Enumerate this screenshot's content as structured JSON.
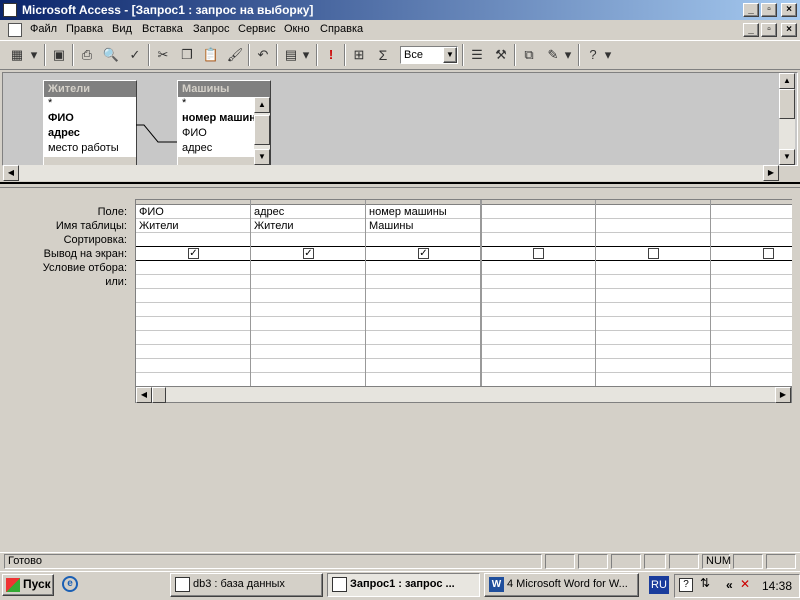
{
  "window": {
    "title": "Microsoft Access - [Запрос1 : запрос на выборку]"
  },
  "menu": [
    "Файл",
    "Правка",
    "Вид",
    "Вставка",
    "Запрос",
    "Сервис",
    "Окно",
    "Справка"
  ],
  "toolbar": {
    "combo_value": "Все"
  },
  "tables": [
    {
      "name": "Жители",
      "fields": [
        "*",
        "ФИО",
        "адрес",
        "место работы"
      ],
      "bold": [
        false,
        true,
        true,
        false
      ]
    },
    {
      "name": "Машины",
      "fields": [
        "*",
        "номер машины",
        "ФИО",
        "адрес"
      ],
      "bold": [
        false,
        true,
        false,
        false
      ]
    }
  ],
  "grid": {
    "row_labels": [
      "Поле:",
      "Имя таблицы:",
      "Сортировка:",
      "Вывод на экран:",
      "Условие отбора:",
      "или:"
    ],
    "columns": [
      {
        "field": "ФИО",
        "table": "Жители",
        "show": true
      },
      {
        "field": "адрес",
        "table": "Жители",
        "show": true
      },
      {
        "field": "номер машины",
        "table": "Машины",
        "show": true
      },
      {
        "field": "",
        "table": "",
        "show": false
      },
      {
        "field": "",
        "table": "",
        "show": false
      },
      {
        "field": "",
        "table": "",
        "show": false
      }
    ]
  },
  "status": {
    "text": "Готово",
    "num": "NUM"
  },
  "taskbar": {
    "start": "Пуск",
    "tasks": [
      "db3 : база данных",
      "Запрос1 : запрос ...",
      "4 Microsoft Word for W..."
    ],
    "lang": "RU",
    "time": "14:38"
  },
  "colors": {
    "titlebar": "#0a246a",
    "face": "#d4d0c8"
  }
}
